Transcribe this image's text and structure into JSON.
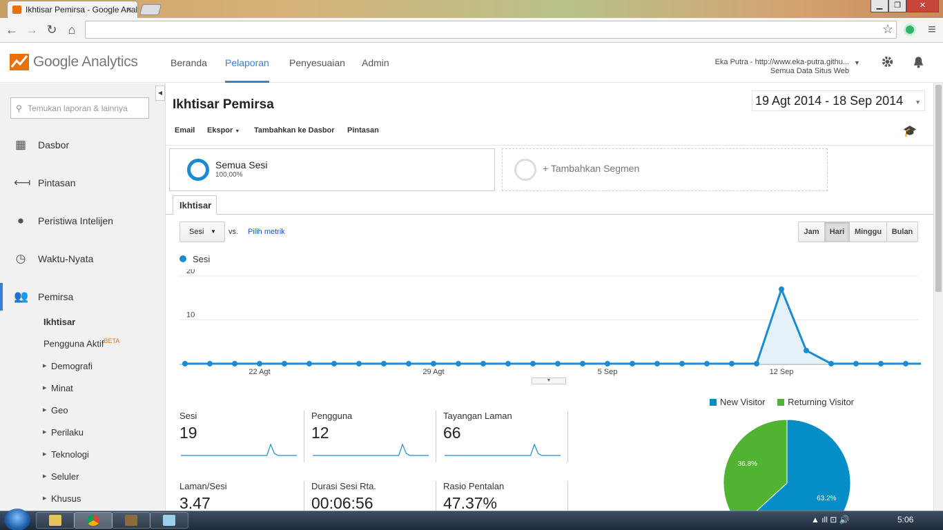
{
  "browser": {
    "tab_title": "Ikhtisar Pemirsa - Google Analytics",
    "tab_close": "×",
    "window_buttons": [
      "▁",
      "❐",
      "✕"
    ],
    "nav": {
      "back": "←",
      "forward": "→",
      "reload": "↻",
      "home": "⌂"
    },
    "url": "",
    "star": "☆",
    "menu": "≡"
  },
  "header": {
    "logo_text": "Google Analytics",
    "nav": [
      "Beranda",
      "Pelaporan",
      "Penyesuaian",
      "Admin"
    ],
    "active_nav": "Pelaporan",
    "account_name": "Eka Putra - http://www.eka-putra.githu...",
    "account_view": "Semua Data Situs Web",
    "colors": {
      "accent": "#3b7ed8",
      "logo_orange": "#e8710a"
    }
  },
  "sidebar": {
    "search_placeholder": "Temukan laporan & lainnya",
    "items": [
      {
        "label": "Dasbor",
        "icon": "grid-icon"
      },
      {
        "label": "Pintasan",
        "icon": "shortcut-arrow-icon"
      },
      {
        "label": "Peristiwa Intelijen",
        "icon": "lightbulb-icon"
      },
      {
        "label": "Waktu-Nyata",
        "icon": "clock-icon"
      },
      {
        "label": "Pemirsa",
        "icon": "people-icon"
      }
    ],
    "subitems": {
      "ikhtisar": "Ikhtisar",
      "pengguna_aktif": "Pengguna Aktif",
      "beta": "BETA",
      "expandable": [
        "Demografi",
        "Minat",
        "Geo",
        "Perilaku",
        "Teknologi",
        "Seluler",
        "Khusus"
      ]
    }
  },
  "main": {
    "title": "Ikhtisar Pemirsa",
    "date_range": "19 Agt 2014 - 18 Sep 2014",
    "actions": {
      "email": "Email",
      "export": "Ekspor",
      "add_dashboard": "Tambahkan ke Dasbor",
      "shortcut": "Pintasan"
    },
    "segment": {
      "name": "Semua Sesi",
      "pct": "100,00%",
      "add": "+ Tambahkan Segmen"
    },
    "tab": "Ikhtisar",
    "metric_select": "Sesi",
    "vs": "vs.",
    "pick_metric": "Pilih metrik",
    "periods": [
      "Jam",
      "Hari",
      "Minggu",
      "Bulan"
    ],
    "active_period": "Hari",
    "legend": "Sesi"
  },
  "chart_data": [
    {
      "type": "area",
      "series": [
        {
          "name": "Sesi",
          "color": "#1a8bd0",
          "values": [
            0,
            0,
            0,
            0,
            0,
            0,
            0,
            0,
            0,
            0,
            0,
            0,
            0,
            0,
            0,
            0,
            0,
            0,
            0,
            0,
            0,
            0,
            0,
            0,
            17,
            3,
            0,
            0,
            0,
            0,
            0,
            0
          ]
        }
      ],
      "x_tick_labels": [
        "22 Agt",
        "29 Agt",
        "5 Sep",
        "12 Sep"
      ],
      "y_ticks": [
        10,
        20
      ],
      "ylim": [
        0,
        20
      ],
      "grid": true
    },
    {
      "type": "pie",
      "labels": [
        "New Visitor",
        "Returning Visitor"
      ],
      "values": [
        63.2,
        36.8
      ],
      "data_labels": [
        "63.2%",
        "36.8%"
      ],
      "colors": [
        "#058dc7",
        "#50b432"
      ],
      "legend": "top"
    }
  ],
  "stats": [
    {
      "label": "Sesi",
      "value": "19"
    },
    {
      "label": "Pengguna",
      "value": "12"
    },
    {
      "label": "Tayangan Laman",
      "value": "66"
    },
    {
      "label": "Laman/Sesi",
      "value": "3.47"
    },
    {
      "label": "Durasi Sesi Rta.",
      "value": "00:06:56"
    },
    {
      "label": "Rasio Pentalan",
      "value": "47.37%"
    }
  ],
  "taskbar": {
    "clock": "5:06",
    "tray": "▲  ıll  ⊡  🔊"
  }
}
